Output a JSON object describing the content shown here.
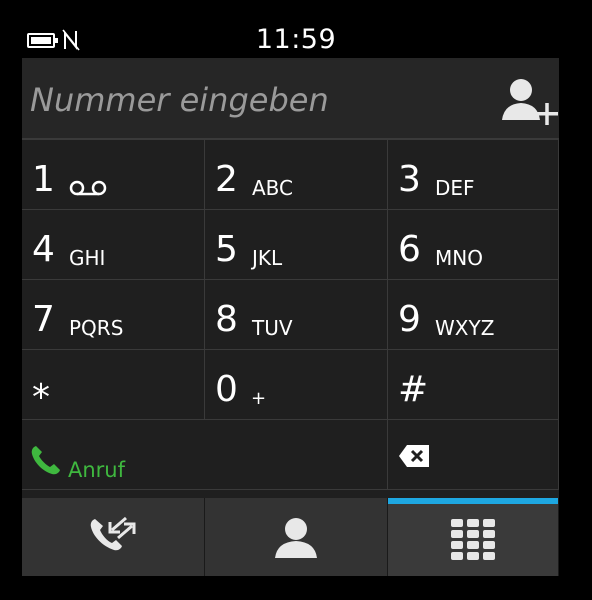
{
  "status": {
    "time": "11:59"
  },
  "dialer": {
    "placeholder": "Nummer eingeben",
    "keys": [
      {
        "digit": "1",
        "letters": "",
        "icon": "voicemail-icon"
      },
      {
        "digit": "2",
        "letters": "ABC"
      },
      {
        "digit": "3",
        "letters": "DEF"
      },
      {
        "digit": "4",
        "letters": "GHI"
      },
      {
        "digit": "5",
        "letters": "JKL"
      },
      {
        "digit": "6",
        "letters": "MNO"
      },
      {
        "digit": "7",
        "letters": "PQRS"
      },
      {
        "digit": "8",
        "letters": "TUV"
      },
      {
        "digit": "9",
        "letters": "WXYZ"
      },
      {
        "digit": "*",
        "letters": ""
      },
      {
        "digit": "0",
        "letters": "+"
      },
      {
        "digit": "#",
        "letters": ""
      }
    ],
    "call_label": "Anruf"
  },
  "tabs": [
    {
      "name": "recent-calls",
      "icon": "call-log-icon"
    },
    {
      "name": "contacts",
      "icon": "person-icon"
    },
    {
      "name": "keypad",
      "icon": "dialpad-icon",
      "active": true
    }
  ],
  "colors": {
    "call_green": "#3fb83f",
    "active_tab_accent": "#1ea7e1",
    "background": "#1f1f1f"
  }
}
